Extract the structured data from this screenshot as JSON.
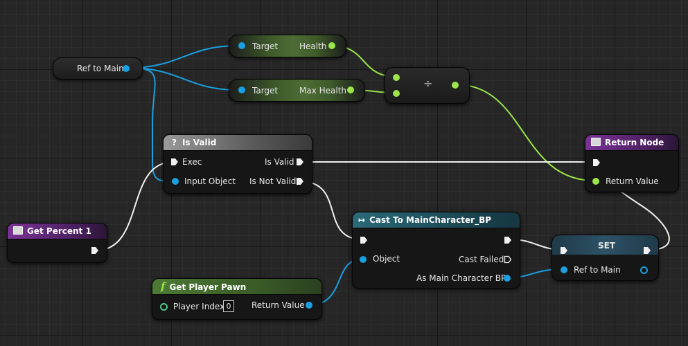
{
  "graph": {
    "ref_to_main_getter": {
      "label": "Ref to Main"
    },
    "get_health": {
      "target_label": "Target",
      "output_label": "Health"
    },
    "get_max_health": {
      "target_label": "Target",
      "output_label": "Max Health"
    },
    "divide": {
      "symbol": "÷"
    },
    "is_valid": {
      "title": "Is Valid",
      "icon_glyph": "?",
      "exec_in_label": "Exec",
      "input_label": "Input Object",
      "out_valid_label": "Is Valid",
      "out_not_valid_label": "Is Not Valid"
    },
    "return_node": {
      "title": "Return Node",
      "return_label": "Return Value"
    },
    "get_percent": {
      "title": "Get Percent 1"
    },
    "cast": {
      "title": "Cast To MainCharacter_BP",
      "icon_glyph": "↦",
      "object_label": "Object",
      "cast_failed_label": "Cast Failed",
      "output_label": "As Main Character BP"
    },
    "set_node": {
      "title": "SET",
      "var_label": "Ref to Main"
    },
    "get_player_pawn": {
      "title": "Get Player Pawn",
      "icon_glyph": "f",
      "index_label": "Player Index",
      "index_value": "0",
      "return_label": "Return Value"
    }
  },
  "colors": {
    "object_pin": "#1a9fe0",
    "float_pin": "#9be54a",
    "exec_wire": "#f0f0f0",
    "function_header": "#6a2a8a",
    "pure_function_header": "#3f6b2c",
    "cast_header": "#1f5a6a",
    "is_valid_header": "#5a5a5a"
  }
}
